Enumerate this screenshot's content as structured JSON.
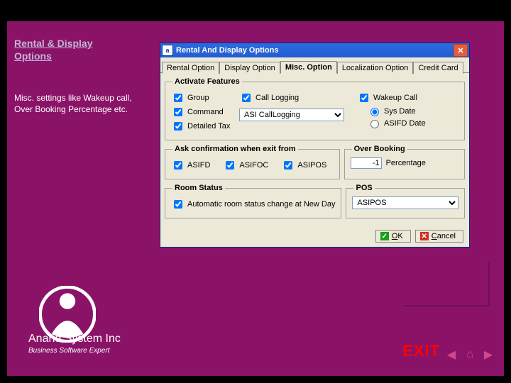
{
  "title": {
    "text": "Rental & Display Options"
  },
  "description": "Misc. settings like Wakeup call, Over Booking Percentage etc.",
  "dialog": {
    "title": "Rental And Display Options",
    "tabs": {
      "rental": "Rental Option",
      "display": "Display Option",
      "misc": "Misc. Option",
      "local": "Localization Option",
      "credit": "Credit Card"
    },
    "activate": {
      "legend": "Activate Features",
      "group": "Group",
      "command": "Command",
      "detailed_tax": "Detailed Tax",
      "call_logging": "Call Logging",
      "call_logging_select": "ASI CallLogging",
      "wakeup": "Wakeup Call",
      "sys_date": "Sys Date",
      "asifd_date": "ASIFD Date"
    },
    "confirm": {
      "legend": "Ask confirmation when exit from",
      "asifd": "ASIFD",
      "asifoc": "ASIFOC",
      "asipos": "ASIPOS"
    },
    "overbooking": {
      "legend": "Over Booking",
      "value": "-1",
      "suffix": "Percentage"
    },
    "roomstatus": {
      "legend": "Room Status",
      "auto": "Automatic room status change at New Day"
    },
    "pos": {
      "legend": "POS",
      "value": "ASIPOS"
    },
    "ok": "OK",
    "cancel": "Cancel"
  },
  "company": {
    "name": "Anand System Inc",
    "tag": "Business Software Expert"
  },
  "exit": "EXIT"
}
